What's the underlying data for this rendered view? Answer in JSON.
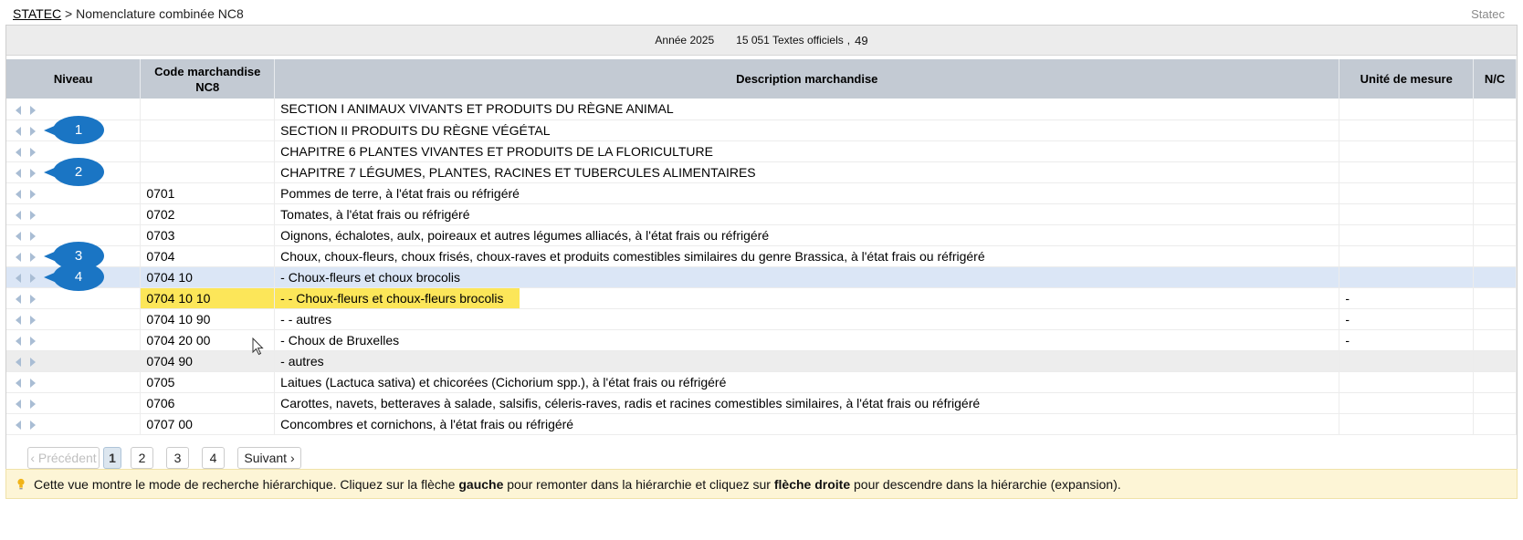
{
  "breadcrumb": {
    "link": "STATEC",
    "separator": " > ",
    "current": "Nomenclature combinée NC8"
  },
  "brand": "Statec",
  "header": {
    "year": "Année 2025",
    "texts": "15 051 Textes officiels",
    "sep": ",",
    "count": "49"
  },
  "columns": {
    "niveau": "Niveau",
    "code_line1": "Code marchandise",
    "code_line2": "NC8",
    "desc": "Description marchandise",
    "unit": "Unité de mesure",
    "nc": "N/C"
  },
  "rows": [
    {
      "code": "",
      "desc": "SECTION I ANIMAUX VIVANTS ET PRODUITS DU RÈGNE ANIMAL",
      "unit": ""
    },
    {
      "code": "",
      "desc": "SECTION II PRODUITS DU RÈGNE VÉGÉTAL",
      "unit": ""
    },
    {
      "code": "",
      "desc": "CHAPITRE 6 PLANTES VIVANTES ET PRODUITS DE LA FLORICULTURE",
      "unit": ""
    },
    {
      "code": "",
      "desc": "CHAPITRE 7 LÉGUMES, PLANTES, RACINES ET TUBERCULES ALIMENTAIRES",
      "unit": ""
    },
    {
      "code": "0701",
      "desc": "Pommes de terre, à l'état frais ou réfrigéré",
      "unit": ""
    },
    {
      "code": "0702",
      "desc": "Tomates, à l'état frais ou réfrigéré",
      "unit": ""
    },
    {
      "code": "0703",
      "desc": "Oignons, échalotes, aulx, poireaux et autres légumes alliacés, à l'état frais ou réfrigéré",
      "unit": ""
    },
    {
      "code": "0704",
      "desc": "Choux, choux-fleurs, choux frisés, choux-raves et produits comestibles similaires du genre Brassica, à l'état frais ou réfrigéré",
      "unit": ""
    },
    {
      "code": "0704 10",
      "desc": "- Choux-fleurs et choux brocolis",
      "unit": ""
    },
    {
      "code": "0704 10 10",
      "desc": "- - Choux-fleurs et choux-fleurs brocolis",
      "unit": "-"
    },
    {
      "code": "0704 10 90",
      "desc": "- - autres",
      "unit": "-"
    },
    {
      "code": "0704 20 00",
      "desc": "- Choux de Bruxelles",
      "unit": "-"
    },
    {
      "code": "0704 90",
      "desc": "- autres",
      "unit": ""
    },
    {
      "code": "0705",
      "desc": "Laitues (Lactuca sativa) et chicorées (Cichorium spp.), à l'état frais ou réfrigéré",
      "unit": ""
    },
    {
      "code": "0706",
      "desc": "Carottes, navets, betteraves à salade, salsifis, céleris-raves, radis et racines comestibles similaires, à l'état frais ou réfrigéré",
      "unit": ""
    },
    {
      "code": "0707 00",
      "desc": "Concombres et cornichons, à l'état frais ou réfrigéré",
      "unit": ""
    }
  ],
  "markers": [
    "1",
    "2",
    "3",
    "4"
  ],
  "pagination": {
    "prev": "‹ Précédent",
    "pages": [
      "1",
      "2",
      "3",
      "4"
    ],
    "next": "Suivant ›"
  },
  "info": {
    "part1": "Cette vue montre le mode de recherche hiérarchique. Cliquez sur la flèche ",
    "bold1": "gauche",
    "part2": " pour remonter dans la hiérarchie et cliquez sur ",
    "bold2": "flèche droite",
    "part3": " pour descendre dans la hiérarchie (expansion)."
  },
  "icons": {
    "nav_left": "triangle-left-icon",
    "nav_right": "triangle-right-icon",
    "info": "lightbulb-icon",
    "cursor": "mouse-pointer-icon"
  },
  "colors": {
    "header_bg": "#c3cad3",
    "selected_row": "#dbe6f6",
    "highlight": "#fce659",
    "marker": "#1a75c4",
    "info_bg": "#fdf5d6"
  }
}
